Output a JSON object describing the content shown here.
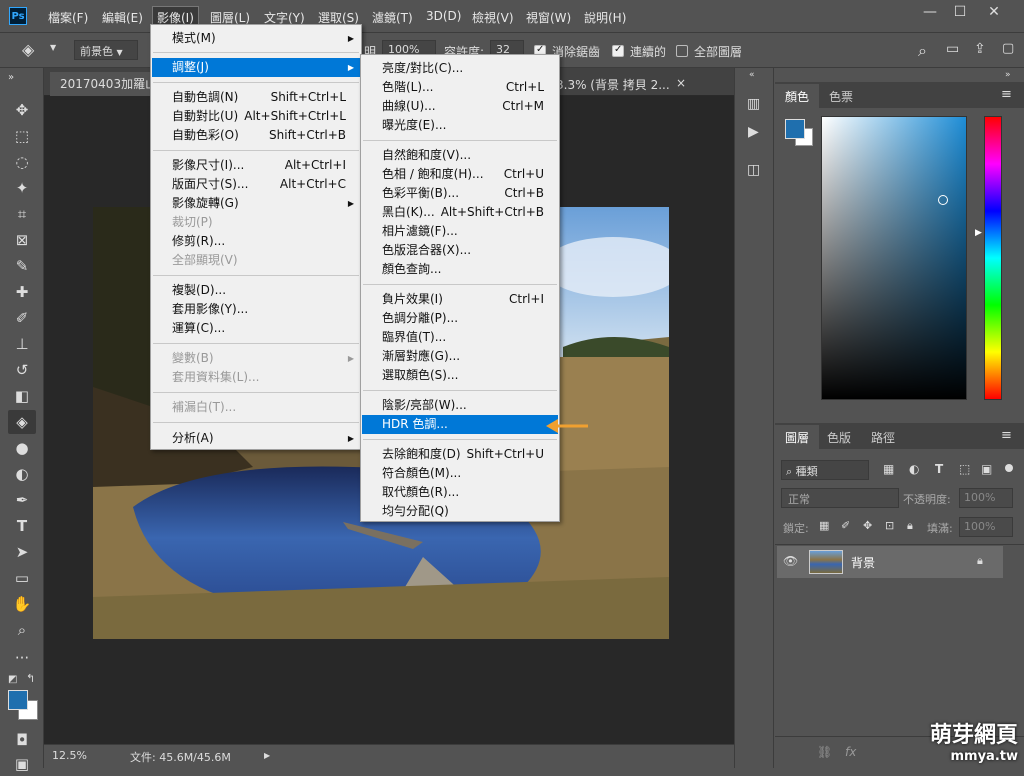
{
  "menubar": {
    "items": [
      "檔案(F)",
      "編輯(E)",
      "影像(I)",
      "圖層(L)",
      "文字(Y)",
      "選取(S)",
      "濾鏡(T)",
      "3D(D)",
      "檢視(V)",
      "視窗(W)",
      "說明(H)"
    ],
    "ps_logo": "Ps",
    "win_minimize": "—",
    "win_restore": "☐",
    "win_close": "✕"
  },
  "options": {
    "fill_source": "前景色",
    "opacity_label": "明",
    "opacity_value": "100%",
    "tolerance_label": "容許度:",
    "tolerance_value": "32",
    "antialias_label": "消除鋸齒",
    "contiguous_label": "連續的",
    "all_layers_label": "全部圖層"
  },
  "document": {
    "tab1": "20170403加羅山",
    "tab2": "3.3% (背景 拷貝 2...",
    "tab2_close": "×",
    "zoom": "12.5%",
    "file_info": "文件: 45.6M/45.6M"
  },
  "image_menu": {
    "items": [
      {
        "label": "模式(M)",
        "shortcut": "",
        "submenu": true,
        "disabled": false
      },
      {
        "label": "調整(J)",
        "shortcut": "",
        "submenu": true,
        "disabled": false,
        "highlight": true
      },
      {
        "label": "自動色調(N)",
        "shortcut": "Shift+Ctrl+L",
        "disabled": false
      },
      {
        "label": "自動對比(U)",
        "shortcut": "Alt+Shift+Ctrl+L",
        "disabled": false
      },
      {
        "label": "自動色彩(O)",
        "shortcut": "Shift+Ctrl+B",
        "disabled": false
      },
      {
        "label": "影像尺寸(I)...",
        "shortcut": "Alt+Ctrl+I",
        "disabled": false
      },
      {
        "label": "版面尺寸(S)...",
        "shortcut": "Alt+Ctrl+C",
        "disabled": false
      },
      {
        "label": "影像旋轉(G)",
        "shortcut": "",
        "submenu": true,
        "disabled": false
      },
      {
        "label": "裁切(P)",
        "shortcut": "",
        "disabled": true
      },
      {
        "label": "修剪(R)...",
        "shortcut": "",
        "disabled": false
      },
      {
        "label": "全部顯現(V)",
        "shortcut": "",
        "disabled": true
      },
      {
        "label": "複製(D)...",
        "shortcut": "",
        "disabled": false
      },
      {
        "label": "套用影像(Y)...",
        "shortcut": "",
        "disabled": false
      },
      {
        "label": "運算(C)...",
        "shortcut": "",
        "disabled": false
      },
      {
        "label": "變數(B)",
        "shortcut": "",
        "submenu": true,
        "disabled": true
      },
      {
        "label": "套用資料集(L)...",
        "shortcut": "",
        "disabled": true
      },
      {
        "label": "補漏白(T)...",
        "shortcut": "",
        "disabled": true
      },
      {
        "label": "分析(A)",
        "shortcut": "",
        "submenu": true,
        "disabled": false
      }
    ]
  },
  "adjust_menu": {
    "items": [
      {
        "label": "亮度/對比(C)...",
        "shortcut": ""
      },
      {
        "label": "色階(L)...",
        "shortcut": "Ctrl+L"
      },
      {
        "label": "曲線(U)...",
        "shortcut": "Ctrl+M"
      },
      {
        "label": "曝光度(E)...",
        "shortcut": ""
      },
      {
        "label": "自然飽和度(V)...",
        "shortcut": ""
      },
      {
        "label": "色相 / 飽和度(H)...",
        "shortcut": "Ctrl+U"
      },
      {
        "label": "色彩平衡(B)...",
        "shortcut": "Ctrl+B"
      },
      {
        "label": "黑白(K)...",
        "shortcut": "Alt+Shift+Ctrl+B"
      },
      {
        "label": "相片濾鏡(F)...",
        "shortcut": ""
      },
      {
        "label": "色版混合器(X)...",
        "shortcut": ""
      },
      {
        "label": "顏色查詢...",
        "shortcut": ""
      },
      {
        "label": "負片效果(I)",
        "shortcut": "Ctrl+I"
      },
      {
        "label": "色調分離(P)...",
        "shortcut": ""
      },
      {
        "label": "臨界值(T)...",
        "shortcut": ""
      },
      {
        "label": "漸層對應(G)...",
        "shortcut": ""
      },
      {
        "label": "選取顏色(S)...",
        "shortcut": ""
      },
      {
        "label": "陰影/亮部(W)...",
        "shortcut": ""
      },
      {
        "label": "HDR 色調...",
        "shortcut": "",
        "highlight": true
      },
      {
        "label": "去除飽和度(D)",
        "shortcut": "Shift+Ctrl+U"
      },
      {
        "label": "符合顏色(M)...",
        "shortcut": ""
      },
      {
        "label": "取代顏色(R)...",
        "shortcut": ""
      },
      {
        "label": "均勻分配(Q)",
        "shortcut": ""
      }
    ]
  },
  "color_panel": {
    "tab_color": "顏色",
    "tab_swatches": "色票",
    "foreground": "#1f6fae",
    "background": "#ffffff"
  },
  "layers_panel": {
    "tab_layers": "圖層",
    "tab_channels": "色版",
    "tab_paths": "路徑",
    "kind_filter": "種類",
    "blend_mode": "正常",
    "opacity_label": "不透明度:",
    "opacity_value": "100%",
    "lock_label": "鎖定:",
    "fill_label": "填滿:",
    "fill_value": "100%",
    "layer_name": "背景"
  },
  "watermark": "萌芽網頁",
  "watermark_url": "mmya.tw",
  "colors": {
    "menu_highlight": "#0078d7",
    "arrow": "#f0a030"
  }
}
